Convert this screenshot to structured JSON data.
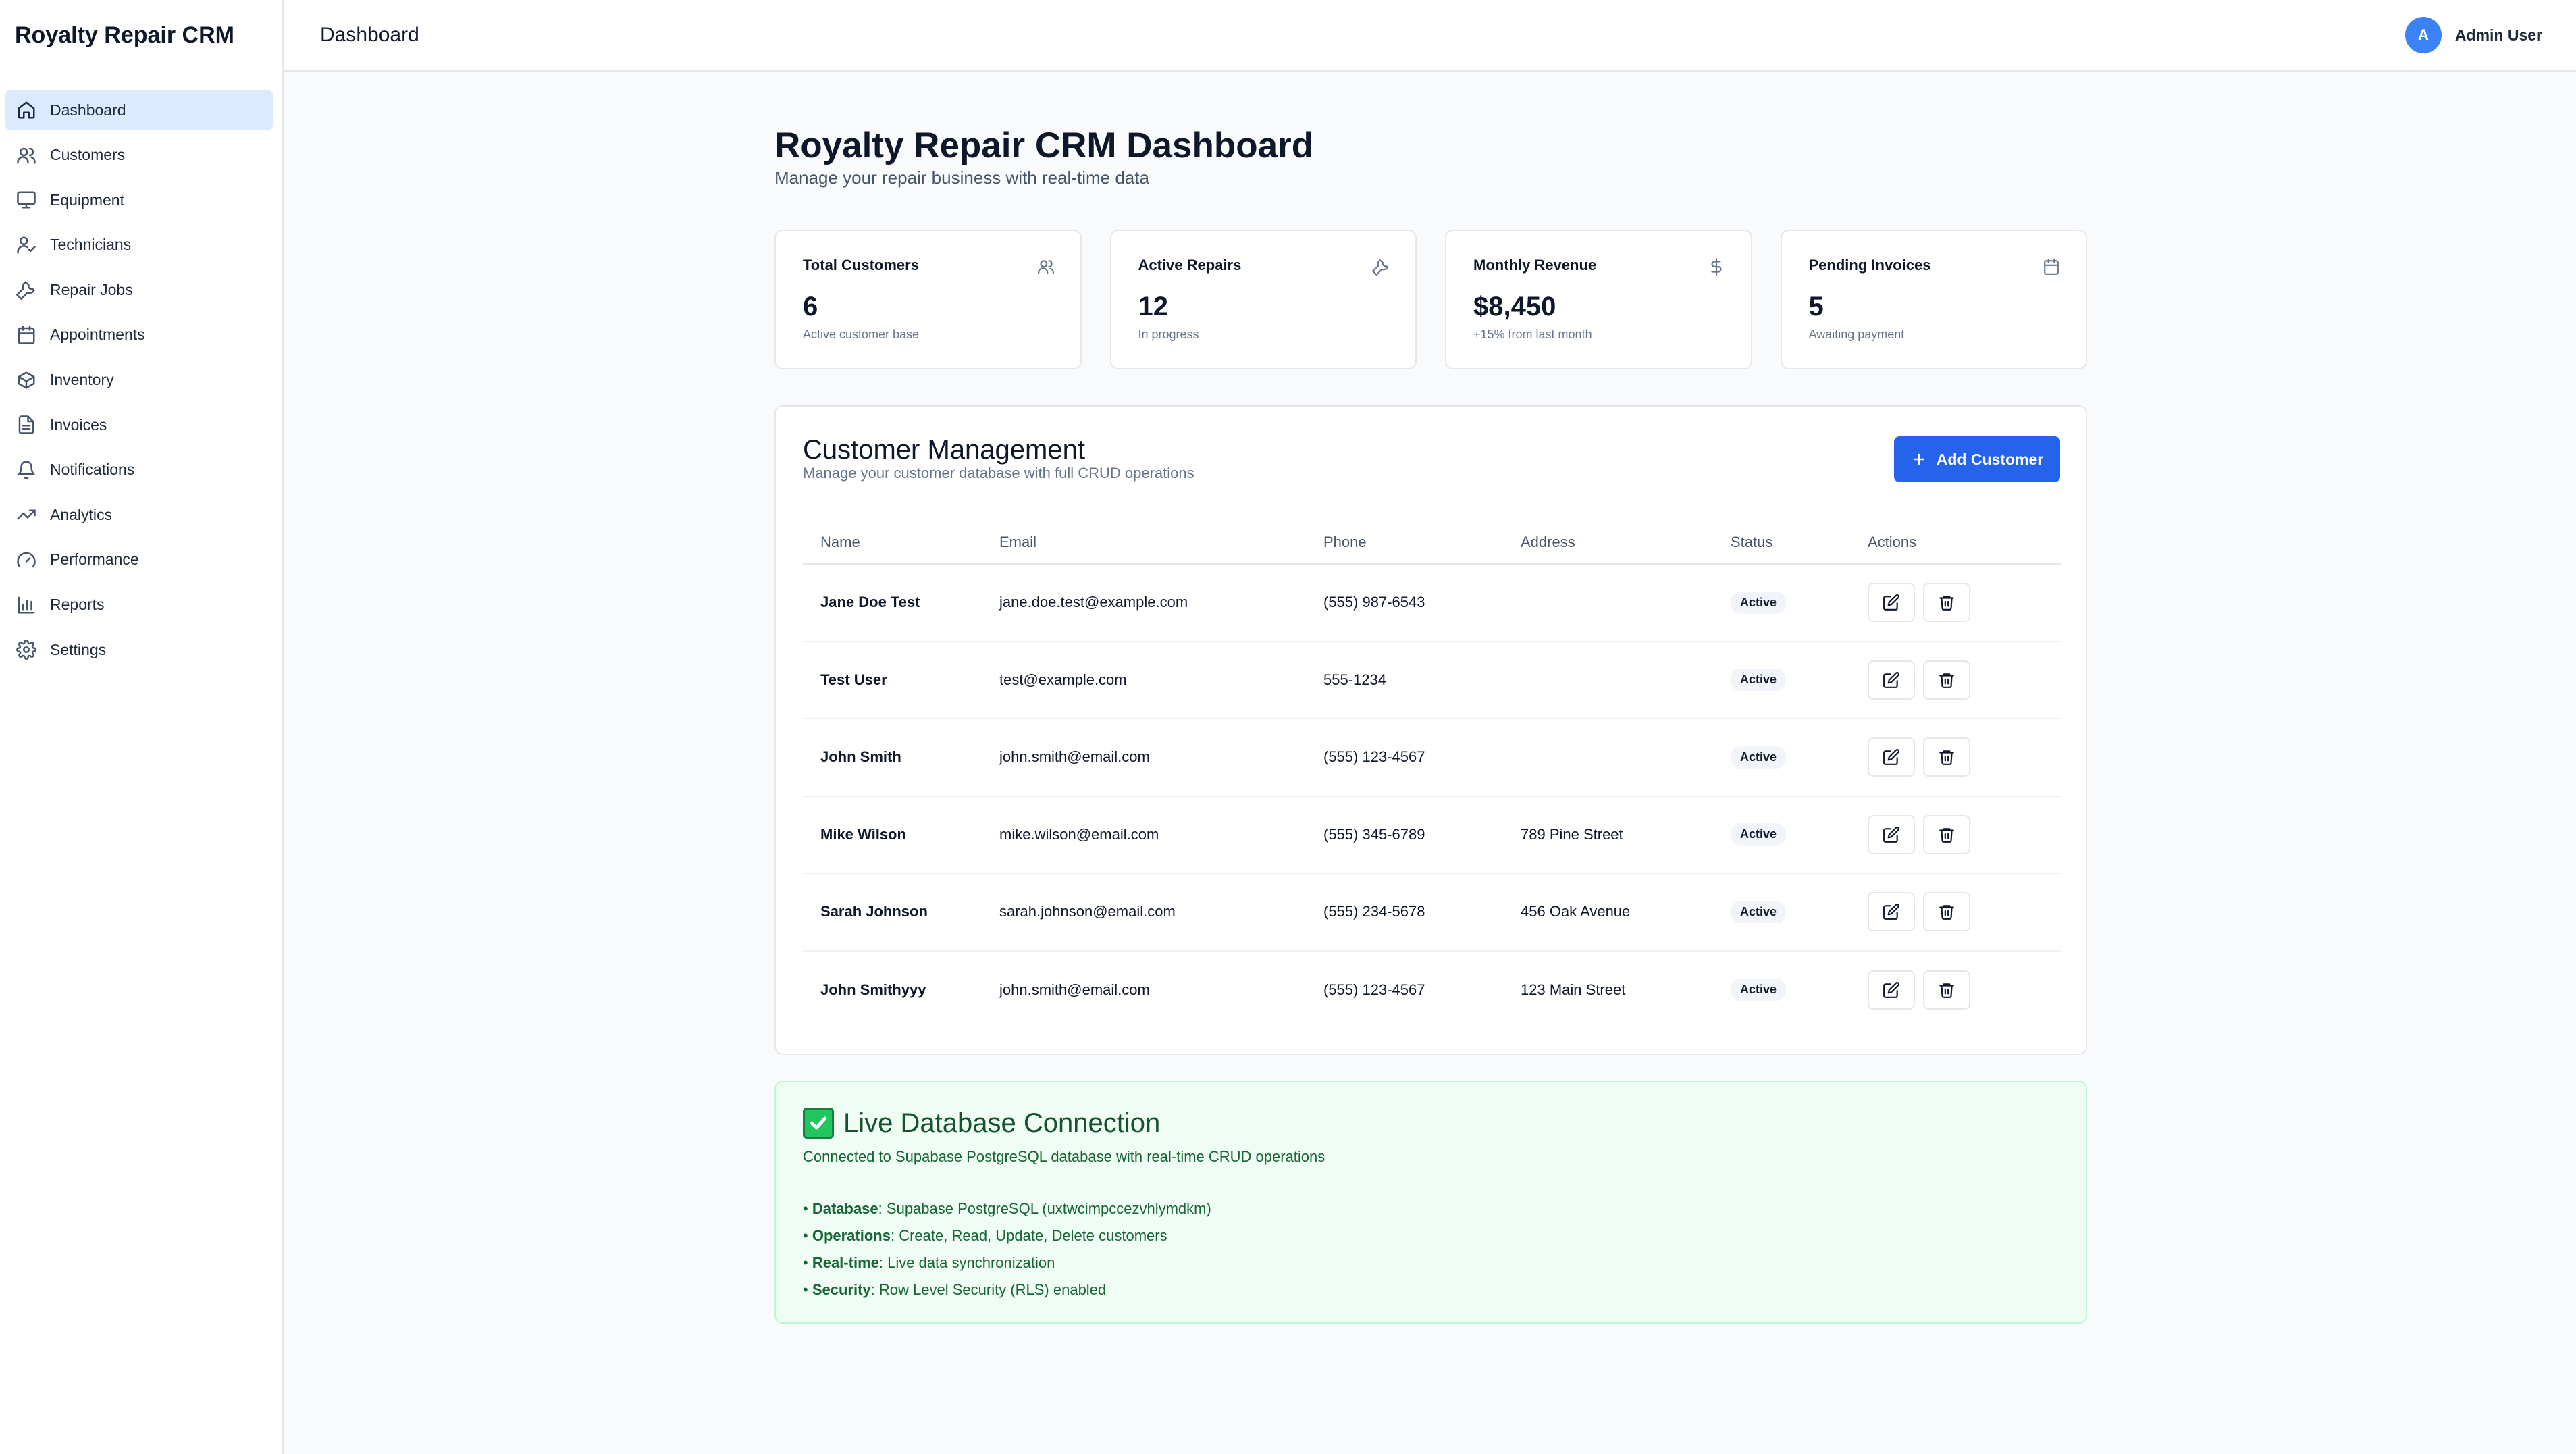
{
  "app": {
    "brand": "Royalty Repair CRM"
  },
  "sidebar": {
    "items": [
      {
        "label": "Dashboard",
        "icon": "home-icon",
        "active": true
      },
      {
        "label": "Customers",
        "icon": "users-icon"
      },
      {
        "label": "Equipment",
        "icon": "monitor-icon"
      },
      {
        "label": "Technicians",
        "icon": "user-check-icon"
      },
      {
        "label": "Repair Jobs",
        "icon": "wrench-icon"
      },
      {
        "label": "Appointments",
        "icon": "calendar-icon"
      },
      {
        "label": "Inventory",
        "icon": "package-icon"
      },
      {
        "label": "Invoices",
        "icon": "file-text-icon"
      },
      {
        "label": "Notifications",
        "icon": "bell-icon"
      },
      {
        "label": "Analytics",
        "icon": "trending-up-icon"
      },
      {
        "label": "Performance",
        "icon": "gauge-icon"
      },
      {
        "label": "Reports",
        "icon": "bar-chart-icon"
      },
      {
        "label": "Settings",
        "icon": "gear-icon"
      }
    ]
  },
  "header": {
    "title": "Dashboard",
    "user_initial": "A",
    "user_name": "Admin User"
  },
  "main": {
    "title": "Royalty Repair CRM Dashboard",
    "subtitle": "Manage your repair business with real-time data"
  },
  "stats": [
    {
      "label": "Total Customers",
      "value": "6",
      "note": "Active customer base",
      "icon": "users-icon"
    },
    {
      "label": "Active Repairs",
      "value": "12",
      "note": "In progress",
      "icon": "wrench-icon"
    },
    {
      "label": "Monthly Revenue",
      "value": "$8,450",
      "note": "+15% from last month",
      "icon": "dollar-icon"
    },
    {
      "label": "Pending Invoices",
      "value": "5",
      "note": "Awaiting payment",
      "icon": "calendar-icon"
    }
  ],
  "customers": {
    "title": "Customer Management",
    "subtitle": "Manage your customer database with full CRUD operations",
    "add_label": "Add Customer",
    "columns": [
      "Name",
      "Email",
      "Phone",
      "Address",
      "Status",
      "Actions"
    ],
    "rows": [
      {
        "name": "Jane Doe Test",
        "email": "jane.doe.test@example.com",
        "phone": "(555) 987-6543",
        "address": "",
        "status": "Active"
      },
      {
        "name": "Test User",
        "email": "test@example.com",
        "phone": "555-1234",
        "address": "",
        "status": "Active"
      },
      {
        "name": "John Smith",
        "email": "john.smith@email.com",
        "phone": "(555) 123-4567",
        "address": "",
        "status": "Active"
      },
      {
        "name": "Mike Wilson",
        "email": "mike.wilson@email.com",
        "phone": "(555) 345-6789",
        "address": "789 Pine Street",
        "status": "Active"
      },
      {
        "name": "Sarah Johnson",
        "email": "sarah.johnson@email.com",
        "phone": "(555) 234-5678",
        "address": "456 Oak Avenue",
        "status": "Active"
      },
      {
        "name": "John Smithyyy",
        "email": "john.smith@email.com",
        "phone": "(555) 123-4567",
        "address": "123 Main Street",
        "status": "Active"
      }
    ]
  },
  "database": {
    "title": "Live Database Connection",
    "subtitle": "Connected to Supabase PostgreSQL database with real-time CRUD operations",
    "items": [
      {
        "key": "Database",
        "value": "Supabase PostgreSQL (uxtwcimpccezvhlymdkm)"
      },
      {
        "key": "Operations",
        "value": "Create, Read, Update, Delete customers"
      },
      {
        "key": "Real-time",
        "value": "Live data synchronization"
      },
      {
        "key": "Security",
        "value": "Row Level Security (RLS) enabled"
      }
    ]
  },
  "colors": {
    "accent": "#2563eb",
    "active_nav": "#dbeafe",
    "success_bg": "#f0fdf4",
    "success_text": "#166534"
  }
}
